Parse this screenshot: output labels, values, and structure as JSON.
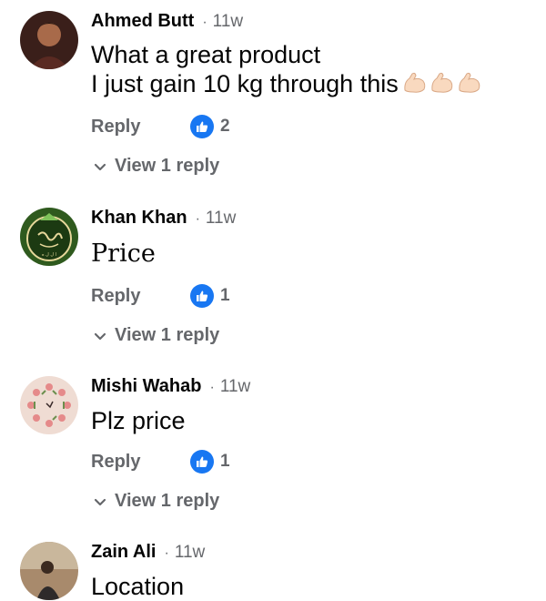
{
  "comments": [
    {
      "author": "Ahmed Butt",
      "separator": "·",
      "time": "11w",
      "text_lines": [
        "What a great product",
        "I just gain 10 kg through this"
      ],
      "emojis": [
        "flexed-biceps-emoji",
        "flexed-biceps-emoji",
        "flexed-biceps-emoji"
      ],
      "reply_label": "Reply",
      "like_count": "2",
      "view_replies_label": "View 1 reply"
    },
    {
      "author": "Khan Khan",
      "separator": "·",
      "time": "11w",
      "text_lines": [
        "Price"
      ],
      "reply_label": "Reply",
      "like_count": "1",
      "view_replies_label": "View 1 reply"
    },
    {
      "author": "Mishi Wahab",
      "separator": "·",
      "time": "11w",
      "text_lines": [
        "Plz price"
      ],
      "reply_label": "Reply",
      "like_count": "1",
      "view_replies_label": "View 1 reply"
    },
    {
      "author": "Zain Ali",
      "separator": "·",
      "time": "11w",
      "text_lines": [
        "Location"
      ]
    }
  ],
  "colors": {
    "like_badge": "#1877f2",
    "secondary_text": "#65676b",
    "primary_text": "#050505"
  },
  "icons": {
    "like": "thumbs-up-icon",
    "expand": "chevron-down-icon"
  }
}
